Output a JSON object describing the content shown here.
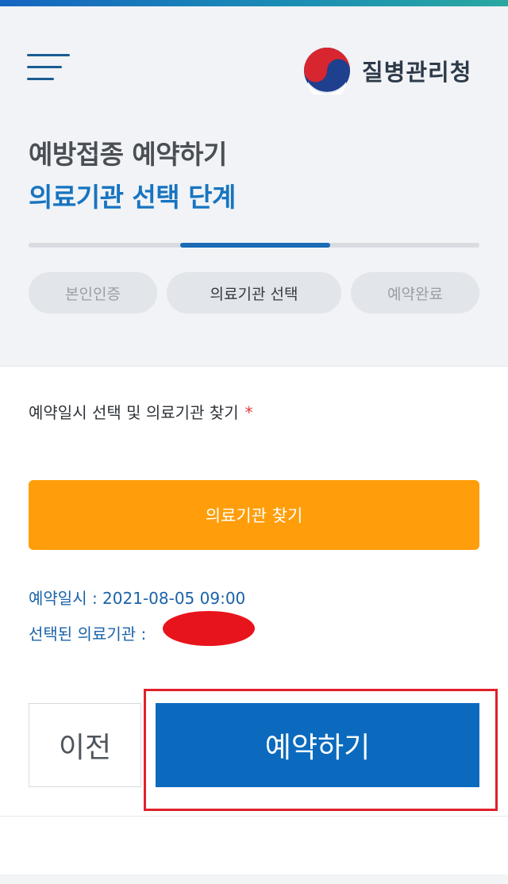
{
  "header": {
    "agency_name": "질병관리청",
    "title": "예방접종 예약하기",
    "subtitle": "의료기관 선택 단계"
  },
  "progress": {
    "current_step": 2,
    "total_steps": 3
  },
  "steps": [
    {
      "label": "본인인증",
      "active": false
    },
    {
      "label": "의료기관 선택",
      "active": true
    },
    {
      "label": "예약완료",
      "active": false
    }
  ],
  "form": {
    "section_label": "예약일시 선택 및 의료기관 찾기",
    "required_mark": "*",
    "find_button": "의료기관 찾기",
    "reservation_datetime": "예약일시 : 2021-08-05 09:00",
    "selected_institution": "선택된 의료기관 :"
  },
  "actions": {
    "prev": "이전",
    "reserve": "예약하기"
  },
  "colors": {
    "primary": "#0b6abd",
    "accent_orange": "#ff9e0a",
    "highlight_red": "#e0202a"
  },
  "icons": {
    "menu": "hamburger-menu-icon",
    "logo": "taegeuk-logo-icon"
  }
}
